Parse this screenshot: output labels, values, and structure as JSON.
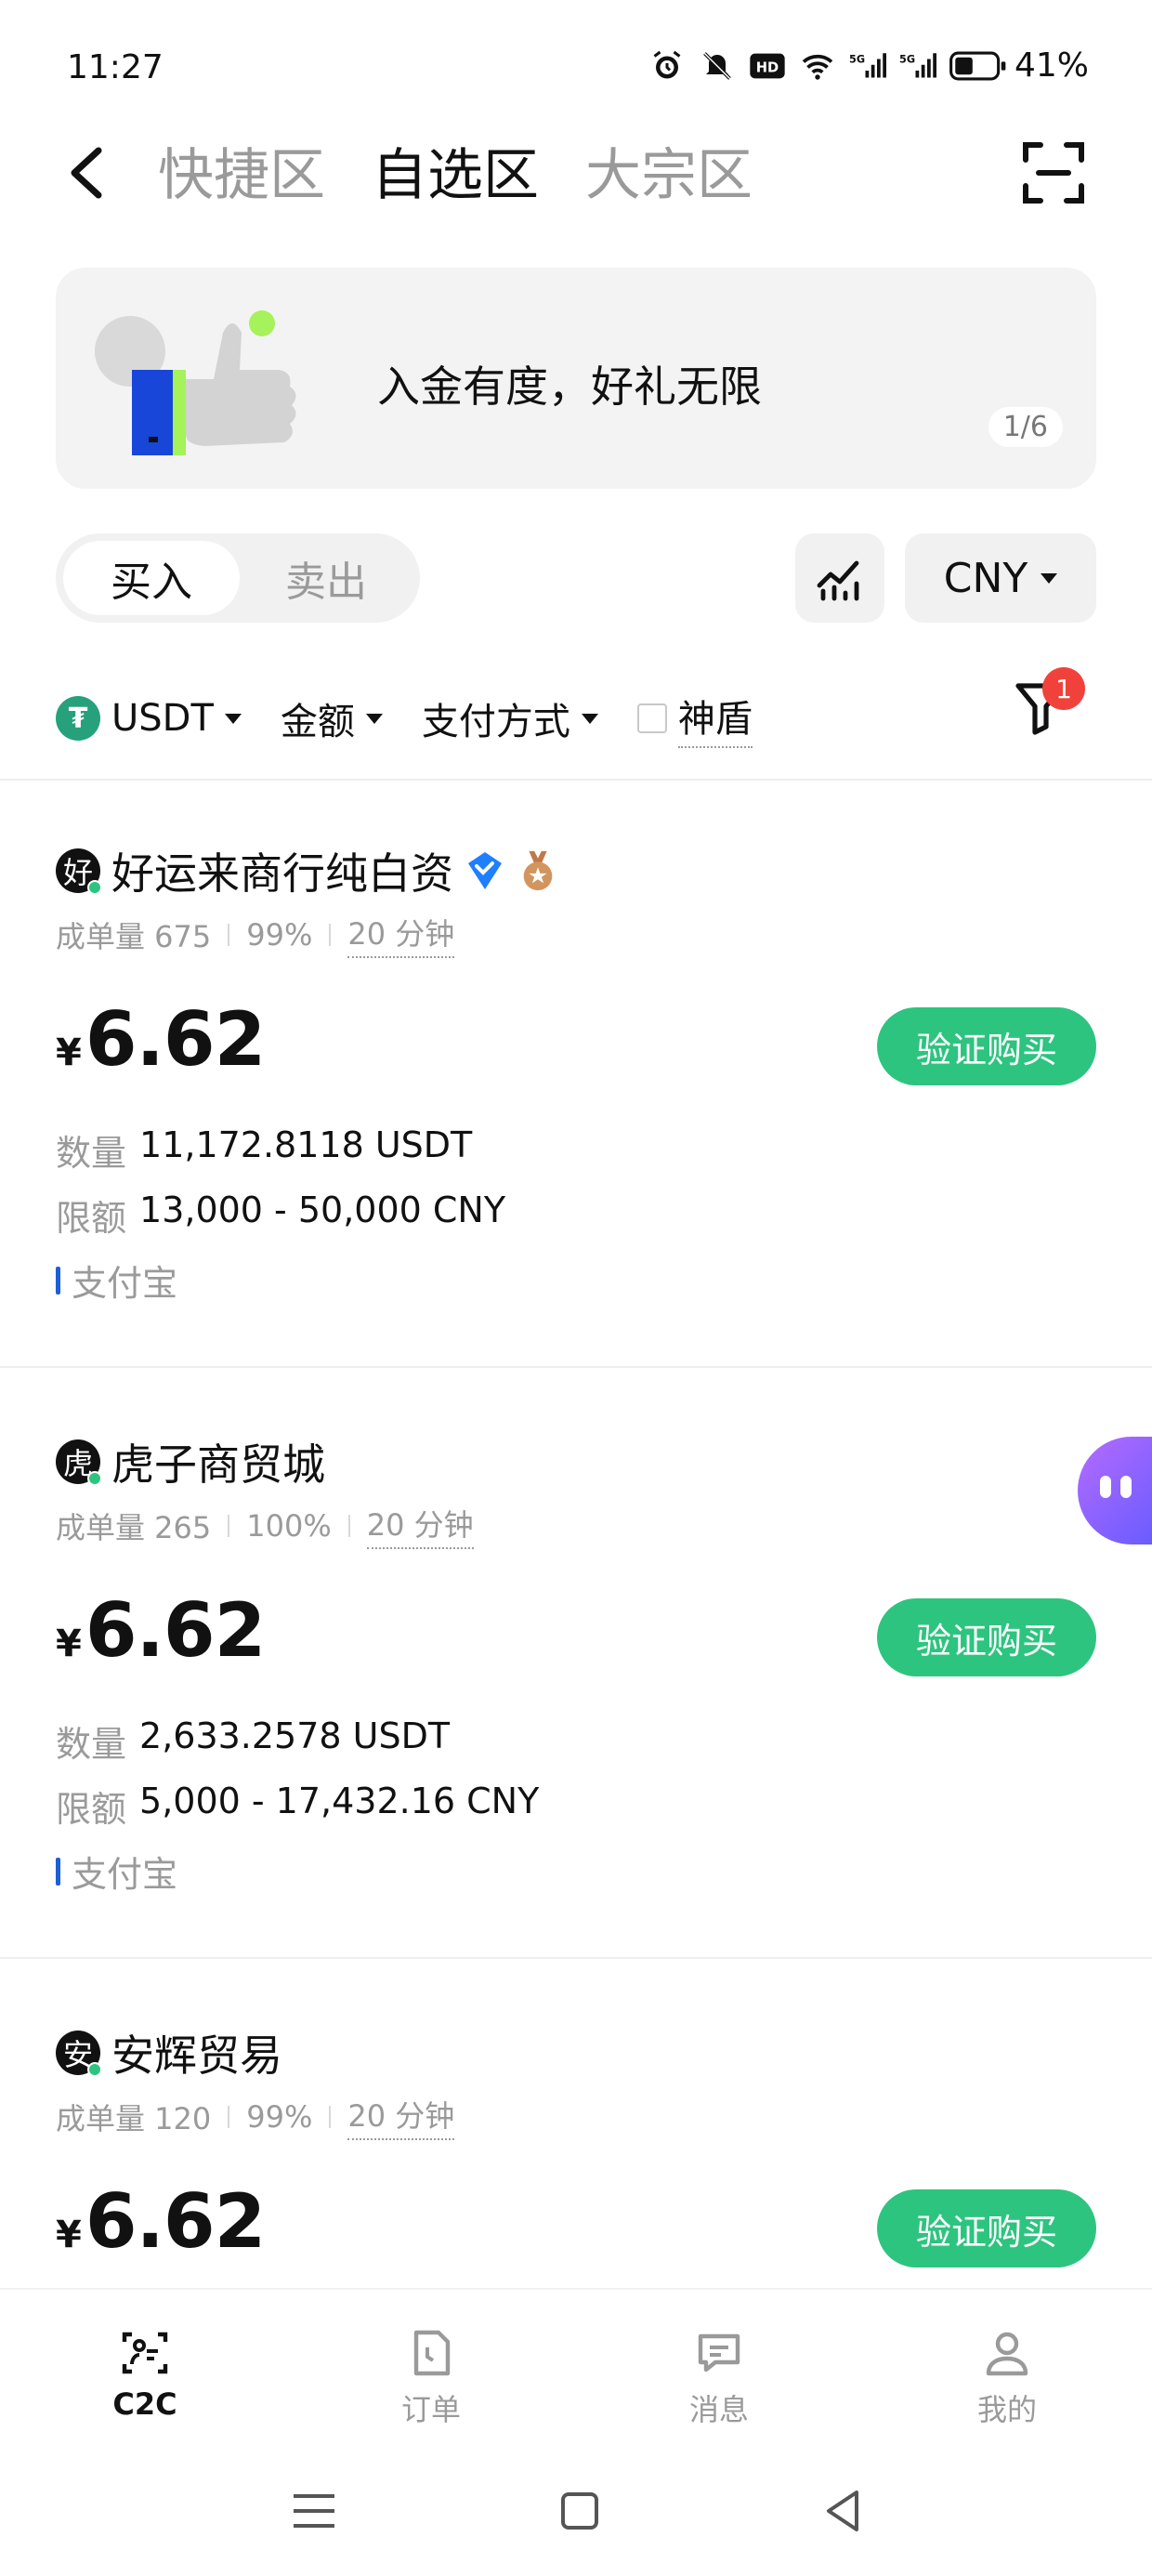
{
  "status_bar": {
    "time": "11:27",
    "icons": [
      "alarm-icon",
      "mute-icon",
      "hd-icon",
      "wifi-icon",
      "5g-signal-icon",
      "5g-signal-icon",
      "battery-icon"
    ],
    "battery_percent": "41%"
  },
  "topnav": {
    "tabs": [
      {
        "label": "快捷区",
        "active": false
      },
      {
        "label": "自选区",
        "active": true
      },
      {
        "label": "大宗区",
        "active": false
      }
    ]
  },
  "banner": {
    "text": "入金有度，好礼无限",
    "pager": "1/6"
  },
  "trade_mode": {
    "buy": "买入",
    "sell": "卖出",
    "selected": "buy"
  },
  "currency": "CNY",
  "filters": {
    "coin": "USDT",
    "amount": "金额",
    "payment": "支付方式",
    "shield": "神盾",
    "badge_count": "1"
  },
  "merchants": [
    {
      "avatar_char": "好",
      "name": "好运来商行纯白资",
      "verified": true,
      "medal": true,
      "orders_label": "成单量 675",
      "completion": "99%",
      "time": "20 分钟",
      "price_symbol": "¥",
      "price": "6.62",
      "button": "验证购买",
      "qty_label": "数量",
      "qty": "11,172.8118 USDT",
      "limit_label": "限额",
      "limit": "13,000 - 50,000 CNY",
      "payment": "支付宝"
    },
    {
      "avatar_char": "虎",
      "name": "虎子商贸城",
      "verified": false,
      "medal": false,
      "orders_label": "成单量 265",
      "completion": "100%",
      "time": "20 分钟",
      "price_symbol": "¥",
      "price": "6.62",
      "button": "验证购买",
      "qty_label": "数量",
      "qty": "2,633.2578 USDT",
      "limit_label": "限额",
      "limit": "5,000 - 17,432.16 CNY",
      "payment": "支付宝"
    },
    {
      "avatar_char": "安",
      "name": "安辉贸易",
      "verified": false,
      "medal": false,
      "orders_label": "成单量 120",
      "completion": "99%",
      "time": "20 分钟",
      "price_symbol": "¥",
      "price": "6.62",
      "button": "验证购买"
    }
  ],
  "bottom_nav": [
    {
      "label": "C2C",
      "icon": "c2c-icon",
      "active": true
    },
    {
      "label": "订单",
      "icon": "orders-icon",
      "active": false
    },
    {
      "label": "消息",
      "icon": "message-icon",
      "active": false
    },
    {
      "label": "我的",
      "icon": "profile-icon",
      "active": false
    }
  ],
  "colors": {
    "accent_green": "#2dc47f",
    "badge_red": "#f0423a",
    "alipay_blue": "#1e5ed8",
    "usdt_green": "#26a17b"
  }
}
